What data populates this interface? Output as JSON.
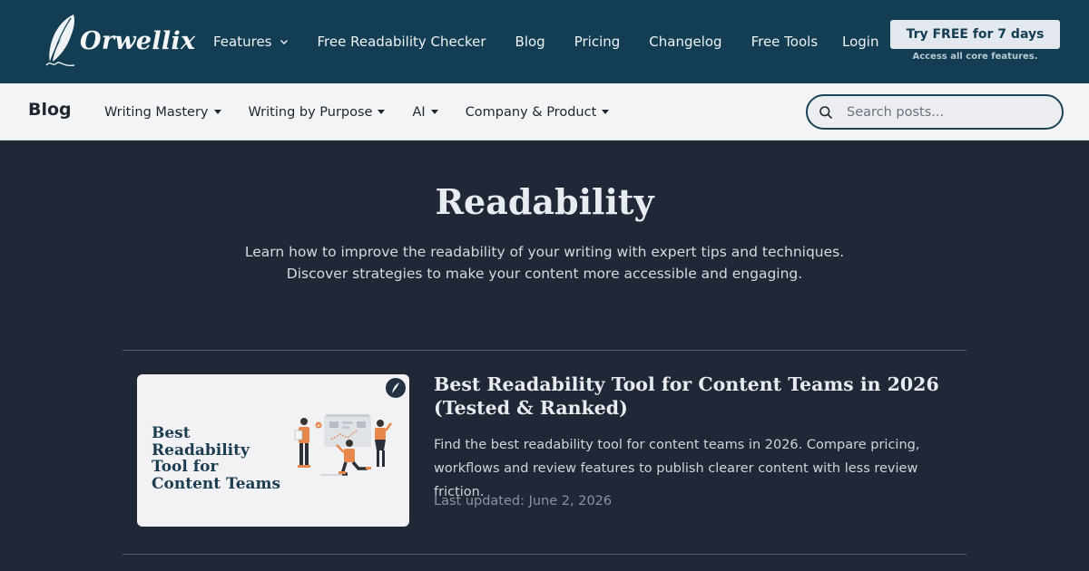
{
  "brand": {
    "name": "Orwellix",
    "logo_icon": "quill-icon"
  },
  "main_nav": {
    "items": [
      {
        "label": "Features",
        "has_dropdown": true
      },
      {
        "label": "Free Readability Checker"
      },
      {
        "label": "Blog"
      },
      {
        "label": "Pricing"
      },
      {
        "label": "Changelog"
      },
      {
        "label": "Free Tools"
      }
    ],
    "login": "Login",
    "cta_label": "Try FREE for 7 days",
    "cta_sub": "Access all core features."
  },
  "blog_nav": {
    "title": "Blog",
    "items": [
      {
        "label": "Writing Mastery"
      },
      {
        "label": "Writing by Purpose"
      },
      {
        "label": "AI"
      },
      {
        "label": "Company & Product"
      }
    ],
    "search_placeholder": "Search posts..."
  },
  "hero": {
    "title": "Readability",
    "description_line1": "Learn how to improve the readability of your writing with expert tips and techniques.",
    "description_line2": "Discover strategies to make your content more accessible and engaging."
  },
  "posts": [
    {
      "thumbnail_text": "Best Readability Tool for Content Teams",
      "title": "Best Readability Tool for Content Teams in 2026 (Tested & Ranked)",
      "excerpt": "Find the best readability tool for content teams in 2026. Compare pricing, workflows and review features to publish clearer content with less review friction.",
      "updated": "Last updated: June 2, 2026"
    }
  ],
  "colors": {
    "header_bg": "#133d52",
    "subnav_bg": "#f3f4f6",
    "page_bg": "#202837",
    "accent_orange": "#e8874a"
  }
}
